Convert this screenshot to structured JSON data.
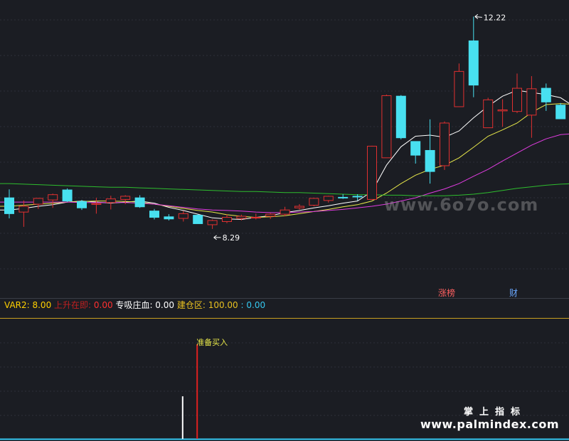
{
  "chart_data": {
    "type": "candlestick",
    "price_range": [
      7.0,
      12.4
    ],
    "candles": [
      {
        "o": 8.78,
        "h": 8.94,
        "l": 8.39,
        "c": 8.48
      },
      {
        "o": 8.51,
        "h": 8.73,
        "l": 8.23,
        "c": 8.62
      },
      {
        "o": 8.66,
        "h": 8.78,
        "l": 8.57,
        "c": 8.77
      },
      {
        "o": 8.74,
        "h": 8.86,
        "l": 8.59,
        "c": 8.84
      },
      {
        "o": 8.93,
        "h": 8.96,
        "l": 8.7,
        "c": 8.72
      },
      {
        "o": 8.71,
        "h": 8.74,
        "l": 8.55,
        "c": 8.59
      },
      {
        "o": 8.66,
        "h": 8.78,
        "l": 8.48,
        "c": 8.67
      },
      {
        "o": 8.69,
        "h": 8.82,
        "l": 8.56,
        "c": 8.76
      },
      {
        "o": 8.75,
        "h": 8.83,
        "l": 8.66,
        "c": 8.81
      },
      {
        "o": 8.78,
        "h": 8.83,
        "l": 8.59,
        "c": 8.61
      },
      {
        "o": 8.53,
        "h": 8.57,
        "l": 8.37,
        "c": 8.41
      },
      {
        "o": 8.42,
        "h": 8.47,
        "l": 8.35,
        "c": 8.38
      },
      {
        "o": 8.39,
        "h": 8.53,
        "l": 8.33,
        "c": 8.48
      },
      {
        "o": 8.45,
        "h": 8.47,
        "l": 8.29,
        "c": 8.29
      },
      {
        "o": 8.27,
        "h": 8.37,
        "l": 8.19,
        "c": 8.35
      },
      {
        "o": 8.33,
        "h": 8.47,
        "l": 8.3,
        "c": 8.41
      },
      {
        "o": 8.39,
        "h": 8.46,
        "l": 8.35,
        "c": 8.43
      },
      {
        "o": 8.4,
        "h": 8.48,
        "l": 8.37,
        "c": 8.41
      },
      {
        "o": 8.43,
        "h": 8.49,
        "l": 8.38,
        "c": 8.47
      },
      {
        "o": 8.47,
        "h": 8.61,
        "l": 8.43,
        "c": 8.55
      },
      {
        "o": 8.59,
        "h": 8.66,
        "l": 8.56,
        "c": 8.62
      },
      {
        "o": 8.64,
        "h": 8.78,
        "l": 8.62,
        "c": 8.77
      },
      {
        "o": 8.73,
        "h": 8.82,
        "l": 8.69,
        "c": 8.81
      },
      {
        "o": 8.79,
        "h": 8.85,
        "l": 8.76,
        "c": 8.78
      },
      {
        "o": 8.81,
        "h": 8.85,
        "l": 8.73,
        "c": 8.8
      },
      {
        "o": 8.75,
        "h": 9.77,
        "l": 8.74,
        "c": 9.76
      },
      {
        "o": 9.54,
        "h": 10.74,
        "l": 9.54,
        "c": 10.72
      },
      {
        "o": 10.71,
        "h": 10.73,
        "l": 9.89,
        "c": 9.92
      },
      {
        "o": 9.85,
        "h": 9.85,
        "l": 9.43,
        "c": 9.59
      },
      {
        "o": 9.68,
        "h": 10.27,
        "l": 9.05,
        "c": 9.28
      },
      {
        "o": 9.39,
        "h": 10.23,
        "l": 9.31,
        "c": 10.2
      },
      {
        "o": 10.51,
        "h": 11.33,
        "l": 10.51,
        "c": 11.18
      },
      {
        "o": 11.76,
        "h": 12.22,
        "l": 10.69,
        "c": 10.92
      },
      {
        "o": 10.11,
        "h": 10.68,
        "l": 10.11,
        "c": 10.64
      },
      {
        "o": 10.43,
        "h": 10.65,
        "l": 10.13,
        "c": 10.45
      },
      {
        "o": 10.42,
        "h": 11.14,
        "l": 10.39,
        "c": 10.86
      },
      {
        "o": 10.35,
        "h": 11.09,
        "l": 9.92,
        "c": 10.85
      },
      {
        "o": 10.86,
        "h": 10.95,
        "l": 10.43,
        "c": 10.6
      },
      {
        "o": 10.54,
        "h": 10.58,
        "l": 10.29,
        "c": 10.28
      },
      {
        "o": 10.14,
        "h": 10.2,
        "l": 9.88,
        "c": 9.93
      }
    ],
    "ma_series": [
      {
        "color": "#ffffff",
        "values": [
          8.55,
          8.58,
          8.62,
          8.65,
          8.7,
          8.72,
          8.7,
          8.68,
          8.7,
          8.72,
          8.68,
          8.6,
          8.54,
          8.47,
          8.4,
          8.38,
          8.37,
          8.41,
          8.44,
          8.5,
          8.54,
          8.59,
          8.63,
          8.68,
          8.72,
          8.9,
          9.4,
          9.75,
          9.95,
          9.97,
          9.93,
          10.05,
          10.3,
          10.52,
          10.71,
          10.82,
          10.78,
          10.74,
          10.68,
          10.5
        ]
      },
      {
        "color": "#e8e84a",
        "values": [
          8.62,
          8.64,
          8.66,
          8.68,
          8.7,
          8.71,
          8.72,
          8.72,
          8.71,
          8.7,
          8.66,
          8.62,
          8.58,
          8.54,
          8.51,
          8.46,
          8.43,
          8.41,
          8.42,
          8.44,
          8.48,
          8.52,
          8.56,
          8.61,
          8.65,
          8.72,
          8.87,
          9.05,
          9.21,
          9.32,
          9.4,
          9.54,
          9.74,
          9.95,
          10.07,
          10.2,
          10.4,
          10.55,
          10.57,
          10.55
        ]
      },
      {
        "color": "#e03ce0",
        "values": [
          8.7,
          8.7,
          8.7,
          8.7,
          8.7,
          8.69,
          8.69,
          8.69,
          8.69,
          8.68,
          8.66,
          8.63,
          8.6,
          8.57,
          8.55,
          8.54,
          8.53,
          8.51,
          8.5,
          8.5,
          8.51,
          8.52,
          8.54,
          8.56,
          8.59,
          8.62,
          8.66,
          8.72,
          8.78,
          8.87,
          8.95,
          9.05,
          9.19,
          9.32,
          9.48,
          9.63,
          9.78,
          9.9,
          9.98,
          10.0
        ]
      },
      {
        "color": "#2ebd2e",
        "values": [
          9.05,
          9.04,
          9.03,
          9.02,
          9.01,
          9.0,
          8.99,
          8.98,
          8.98,
          8.97,
          8.96,
          8.95,
          8.94,
          8.93,
          8.92,
          8.91,
          8.9,
          8.9,
          8.89,
          8.88,
          8.88,
          8.87,
          8.86,
          8.85,
          8.84,
          8.84,
          8.83,
          8.83,
          8.82,
          8.82,
          8.82,
          8.83,
          8.85,
          8.88,
          8.92,
          8.96,
          8.99,
          9.02,
          9.04,
          9.05
        ]
      }
    ],
    "annotations": {
      "high": "12.22",
      "low": "8.29",
      "tag1": "涨榜",
      "tag2": "财"
    },
    "indicator": {
      "var2_label": "VAR2: ",
      "var2_value": "8.00",
      "up_label": "上升在即: ",
      "up_value": "0.00",
      "zhuang_label": "专吸庄血: ",
      "zhuang_value": "0.00",
      "jiancang_label": "建仓区: ",
      "jiancang_value": "100.00",
      "extra_label": " : ",
      "extra_value": "0.00",
      "signal_text": "准备买入"
    },
    "signals": [
      {
        "index": 12,
        "color": "#ffffff",
        "level": 0.45
      },
      {
        "index": 13,
        "color": "#e02020",
        "level": 1.0
      }
    ]
  },
  "watermark": "www.6o7o.com",
  "brand": {
    "cn": "掌上指标",
    "url": "www.palmindex.com"
  }
}
